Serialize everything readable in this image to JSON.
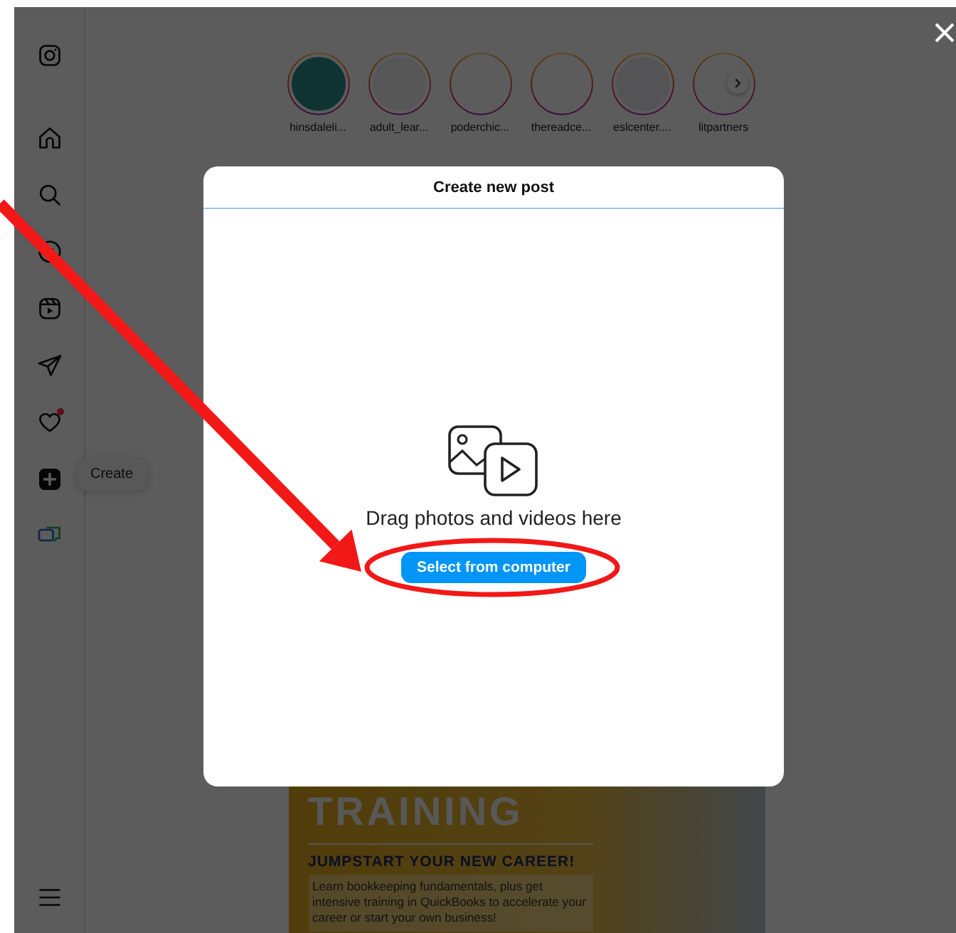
{
  "sidebar": {
    "activity_notification": true,
    "tooltip": "Create"
  },
  "stories": [
    {
      "username": "hinsdaleli..."
    },
    {
      "username": "adult_lear..."
    },
    {
      "username": "poderchic..."
    },
    {
      "username": "thereadce..."
    },
    {
      "username": "eslcenter...."
    },
    {
      "username": "litpartners"
    }
  ],
  "modal": {
    "title": "Create new post",
    "prompt": "Drag photos and videos here",
    "button": "Select from computer"
  },
  "post": {
    "headline": "TRAINING",
    "subheadline": "JUMPSTART YOUR NEW CAREER!",
    "body": "Learn bookkeeping fundamentals, plus get intensive training in QuickBooks to accelerate your career or start your own business!"
  },
  "annotations": [
    {
      "kind": "arrow"
    },
    {
      "kind": "ellipse"
    }
  ]
}
